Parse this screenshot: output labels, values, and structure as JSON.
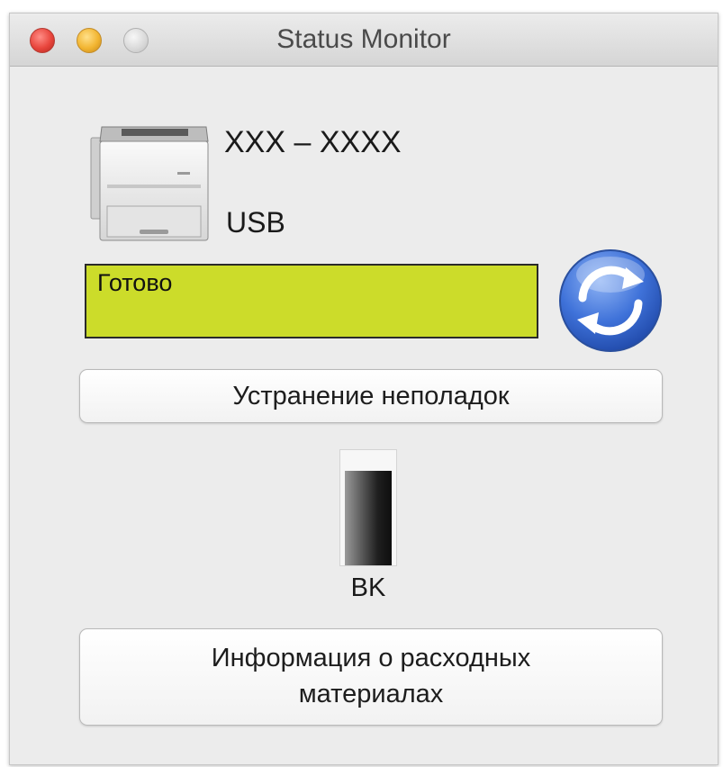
{
  "window": {
    "title": "Status Monitor"
  },
  "device": {
    "model": "XXX – XXXX",
    "connection": "USB"
  },
  "status": {
    "text": "Готово",
    "color": "#ccdc2a"
  },
  "buttons": {
    "troubleshooting": "Устранение неполадок",
    "supplies_line1": "Информация о расходных",
    "supplies_line2": "материалах"
  },
  "toner": {
    "label": "BK",
    "level_fraction": 0.82
  },
  "icons": {
    "printer": "printer-icon",
    "refresh": "refresh-icon",
    "close": "close-icon",
    "minimize": "minimize-icon",
    "zoom": "zoom-icon"
  }
}
